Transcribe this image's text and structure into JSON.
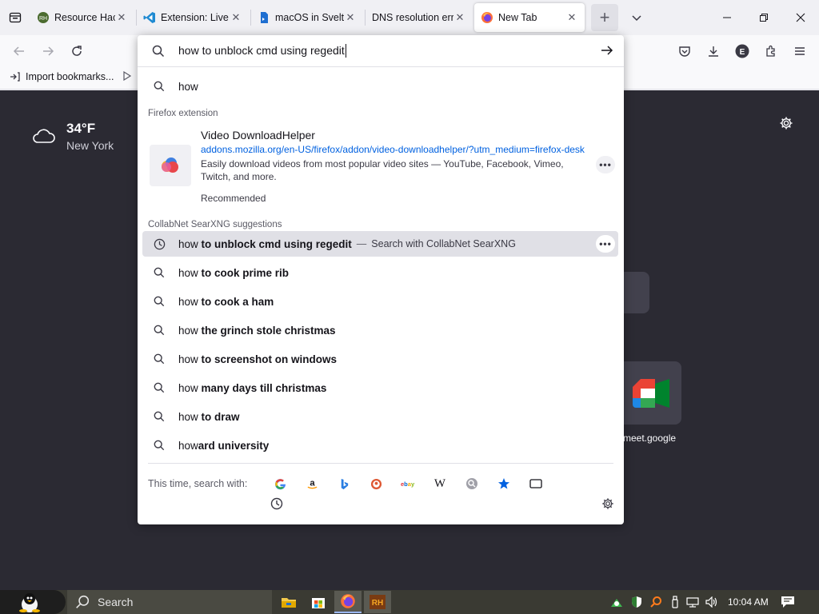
{
  "browser": {
    "tabs": [
      {
        "title": "Resource Hacke",
        "icon": "resource-hacker-icon",
        "active": false
      },
      {
        "title": "Extension: Live S",
        "icon": "vscode-icon",
        "active": false
      },
      {
        "title": "macOS in Svelte",
        "icon": "svelte-doc-icon",
        "active": false
      },
      {
        "title": "DNS resolution error",
        "icon": "none",
        "active": false
      },
      {
        "title": "New Tab",
        "icon": "firefox-icon",
        "active": true
      }
    ],
    "bookmarks": {
      "import_label": "Import bookmarks..."
    }
  },
  "urlbar": {
    "typed_text": "how to unblock cmd using regedit",
    "first_suggestion": "how"
  },
  "extension_group": {
    "label": "Firefox extension",
    "title": "Video DownloadHelper",
    "url": "addons.mozilla.org/en-US/firefox/addon/video-downloadhelper/?utm_medium=firefox-desktop",
    "description": "Easily download videos from most popular video sites — YouTube, Facebook, Vimeo, Twitch, and more.",
    "recommended": "Recommended"
  },
  "suggestions_group": {
    "label": "CollabNet SearXNG suggestions",
    "selected": {
      "prefix": "how",
      "bold": " to unblock cmd using regedit",
      "separator": "—",
      "action": "Search with CollabNet SearXNG"
    },
    "items": [
      {
        "prefix": "how",
        "bold": " to cook prime rib"
      },
      {
        "prefix": "how",
        "bold": " to cook a ham"
      },
      {
        "prefix": "how",
        "bold": " the grinch stole christmas"
      },
      {
        "prefix": "how",
        "bold": " to screenshot on windows"
      },
      {
        "prefix": "how",
        "bold": " many days till christmas"
      },
      {
        "prefix": "how",
        "bold": " to draw"
      },
      {
        "prefix": "how",
        "bold": "ard university"
      }
    ]
  },
  "one_off": {
    "label": "This time, search with:",
    "engines": [
      "Google",
      "Amazon",
      "Bing",
      "DuckDuckGo",
      "eBay",
      "Wikipedia",
      "SearXNG",
      "Bookmarks",
      "Tabs",
      "History"
    ]
  },
  "newtab": {
    "weather": {
      "temp": "34°F",
      "city": "New York"
    },
    "shortcut_label": "meet.google"
  },
  "taskbar": {
    "search_placeholder": "Search",
    "time": "10:04 AM"
  },
  "colors": {
    "accent": "#0061e0",
    "panel_bg": "#ffffff",
    "newtab_bg": "#2b2a33"
  }
}
